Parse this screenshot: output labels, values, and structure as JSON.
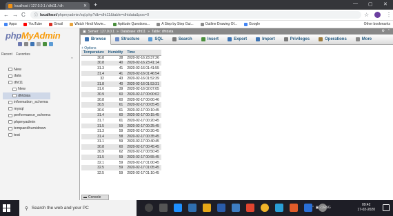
{
  "browser": {
    "tab_title": "localhost / 127.0.0.1 / dht11 / dh",
    "tab_close": "✕",
    "new_tab": "+",
    "win_min": "—",
    "win_max": "▢",
    "win_close": "✕",
    "nav_back": "←",
    "nav_forward": "→",
    "nav_reload": "C",
    "url_host": "localhost",
    "url_path": "/phpmyadmin/sql.php?db=dht11&table=dhtdata&pos=0",
    "star": "☆",
    "kebab": "⋮"
  },
  "bookmarks": {
    "items": [
      {
        "label": "Apps",
        "color": "#4285f4"
      },
      {
        "label": "YouTube",
        "color": "#ff0000"
      },
      {
        "label": "Gmail",
        "color": "#d93025"
      },
      {
        "label": "Watch Hindi Movie...",
        "color": "#e8a33d"
      },
      {
        "label": "Aptitude Questions...",
        "color": "#4a8f3c"
      },
      {
        "label": "A Step by Step Gui...",
        "color": "#8a8a8a"
      },
      {
        "label": "Outline Drawing Of...",
        "color": "#8a8a8a"
      },
      {
        "label": "Google",
        "color": "#4285f4"
      }
    ],
    "other": "Other bookmarks"
  },
  "left_panel": {
    "logo_php": "php",
    "logo_my": "MyAdmin",
    "recent_label": "Recent",
    "favorites_label": "Favorites",
    "collapse_icon": "⇔",
    "tree": [
      {
        "label": "New",
        "level": 0
      },
      {
        "label": "data",
        "level": 0
      },
      {
        "label": "dht11",
        "level": 0
      },
      {
        "label": "New",
        "level": 1
      },
      {
        "label": "dhtdata",
        "level": 1
      },
      {
        "label": "information_schema",
        "level": 0
      },
      {
        "label": "mysql",
        "level": 0
      },
      {
        "label": "performance_schema",
        "level": 0
      },
      {
        "label": "phpmyadmin",
        "level": 0
      },
      {
        "label": "tempandhumidnew",
        "level": 0
      },
      {
        "label": "test",
        "level": 0
      }
    ]
  },
  "breadcrumb": {
    "server": "Server: 127.0.0.1",
    "database": "Database: dht11",
    "table": "Table: dhtdata",
    "sep": "»"
  },
  "tabs": [
    {
      "label": "Browse",
      "color": "#3d74b4"
    },
    {
      "label": "Structure",
      "color": "#6b8cc7"
    },
    {
      "label": "SQL",
      "color": "#5b9bd5"
    },
    {
      "label": "Search",
      "color": "#7a7a7a"
    },
    {
      "label": "Insert",
      "color": "#4a8f3c"
    },
    {
      "label": "Export",
      "color": "#3d74b4"
    },
    {
      "label": "Import",
      "color": "#3d74b4"
    },
    {
      "label": "Privileges",
      "color": "#7a7a7a"
    },
    {
      "label": "Operations",
      "color": "#9a7a3c"
    },
    {
      "label": "More",
      "color": "#888888"
    }
  ],
  "options_link": "+ Options",
  "table": {
    "headers": [
      "Temperature",
      "Humidity",
      "Time"
    ],
    "rows": [
      [
        "30.8",
        "38",
        "2020-02-16 23:37:26"
      ],
      [
        "30.8",
        "40",
        "2020-02-16 23:41:14"
      ],
      [
        "31.3",
        "41",
        "2020-02-16 01:41:55"
      ],
      [
        "31.4",
        "41",
        "2020-02-16 01:46:54"
      ],
      [
        "32",
        "43",
        "2020-02-16 01:52:39"
      ],
      [
        "31.8",
        "40",
        "2020-02-16 01:53:31"
      ],
      [
        "31.6",
        "39",
        "2020-02-16 02:07:05"
      ],
      [
        "30.9",
        "60",
        "2020-02-17 00:00:02"
      ],
      [
        "30.8",
        "60",
        "2020-02-17 00:00:46"
      ],
      [
        "30.5",
        "61",
        "2020-02-17 00:05:45"
      ],
      [
        "30.6",
        "61",
        "2020-02-17 00:10:45"
      ],
      [
        "31.4",
        "60",
        "2020-02-17 00:15:45"
      ],
      [
        "31.7",
        "61",
        "2020-02-17 00:20:45"
      ],
      [
        "31.5",
        "59",
        "2020-02-17 00:25:45"
      ],
      [
        "31.3",
        "59",
        "2020-02-17 00:30:45"
      ],
      [
        "31.4",
        "58",
        "2020-02-17 00:35:45"
      ],
      [
        "31.1",
        "59",
        "2020-02-17 00:40:45"
      ],
      [
        "30.8",
        "60",
        "2020-02-17 00:45:45"
      ],
      [
        "30.9",
        "62",
        "2020-02-17 00:50:45"
      ],
      [
        "31.5",
        "59",
        "2020-02-17 00:55:45"
      ],
      [
        "32.1",
        "59",
        "2020-02-17 01:00:45"
      ],
      [
        "32.5",
        "59",
        "2020-02-17 01:05:45"
      ],
      [
        "32.5",
        "59",
        "2020-02-17 01:10:45"
      ]
    ]
  },
  "console_label": "Console",
  "taskbar": {
    "search_placeholder": "Search the web and your PC",
    "time": "09:42",
    "date": "17-02-2020",
    "lang": "ENG"
  }
}
